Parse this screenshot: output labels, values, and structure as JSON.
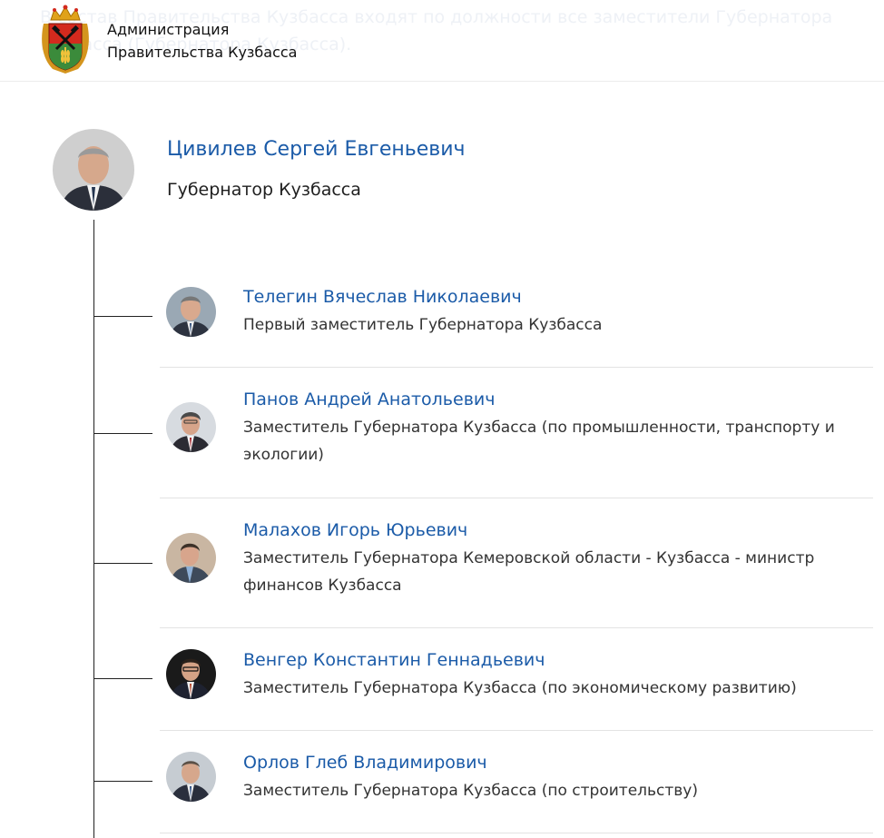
{
  "header": {
    "bg_text": "В состав Правительства Кузбасса входят по должности все заместители Губернатора Кузбасса (Губернатора Кузбасса).",
    "brand_line1": "Администрация",
    "brand_line2": "Правительства Кузбасса",
    "logo_icon": "kuzbass-coat-of-arms-icon"
  },
  "governor": {
    "name": "Цивилев Сергей Евгеньевич",
    "title": "Губернатор Кузбасса"
  },
  "members": [
    {
      "name": "Телегин Вячеслав Николаевич",
      "position": "Первый заместитель Губернатора Кузбасса"
    },
    {
      "name": "Панов Андрей Анатольевич",
      "position": "Заместитель Губернатора Кузбасса (по промышленности, транспорту и экологии)"
    },
    {
      "name": "Малахов Игорь Юрьевич",
      "position": "Заместитель Губернатора Кемеровской области - Кузбасса - министр финансов Кузбасса"
    },
    {
      "name": "Венгер Константин Геннадьевич",
      "position": "Заместитель Губернатора Кузбасса (по экономическому развитию)"
    },
    {
      "name": "Орлов Глеб Владимирович",
      "position": "Заместитель Губернатора Кузбасса (по строительству)"
    }
  ],
  "colors": {
    "link": "#1b5ba8",
    "text": "#1f1f1f",
    "divider": "#e3e3e3",
    "tree_line": "#222222"
  }
}
